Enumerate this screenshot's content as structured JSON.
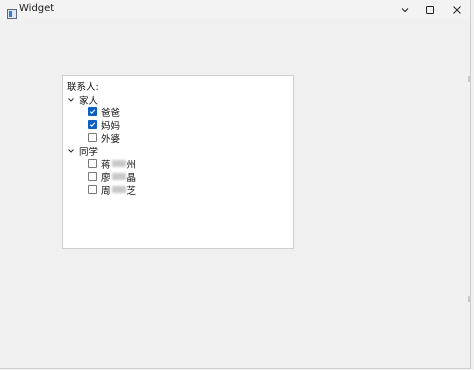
{
  "window": {
    "title": "Widget",
    "controls": {
      "minimize_icon": "chevron-down-icon",
      "maximize_icon": "square-icon",
      "close_icon": "close-icon"
    }
  },
  "tree": {
    "header": "联系人:",
    "groups": [
      {
        "label": "家人",
        "expanded": true,
        "items": [
          {
            "label": "爸爸",
            "checked": true
          },
          {
            "label": "妈妈",
            "checked": true
          },
          {
            "label": "外婆",
            "checked": false
          }
        ]
      },
      {
        "label": "同学",
        "expanded": true,
        "items": [
          {
            "label_start": "蒋",
            "label_end": "州",
            "checked": false
          },
          {
            "label_start": "廖",
            "label_end": "晶",
            "checked": false
          },
          {
            "label_start": "周",
            "label_end": "芝",
            "checked": false
          }
        ]
      }
    ]
  },
  "colors": {
    "checked": "#0a5dc2",
    "window_bg": "#f0f0f0",
    "tree_bg": "#ffffff"
  }
}
